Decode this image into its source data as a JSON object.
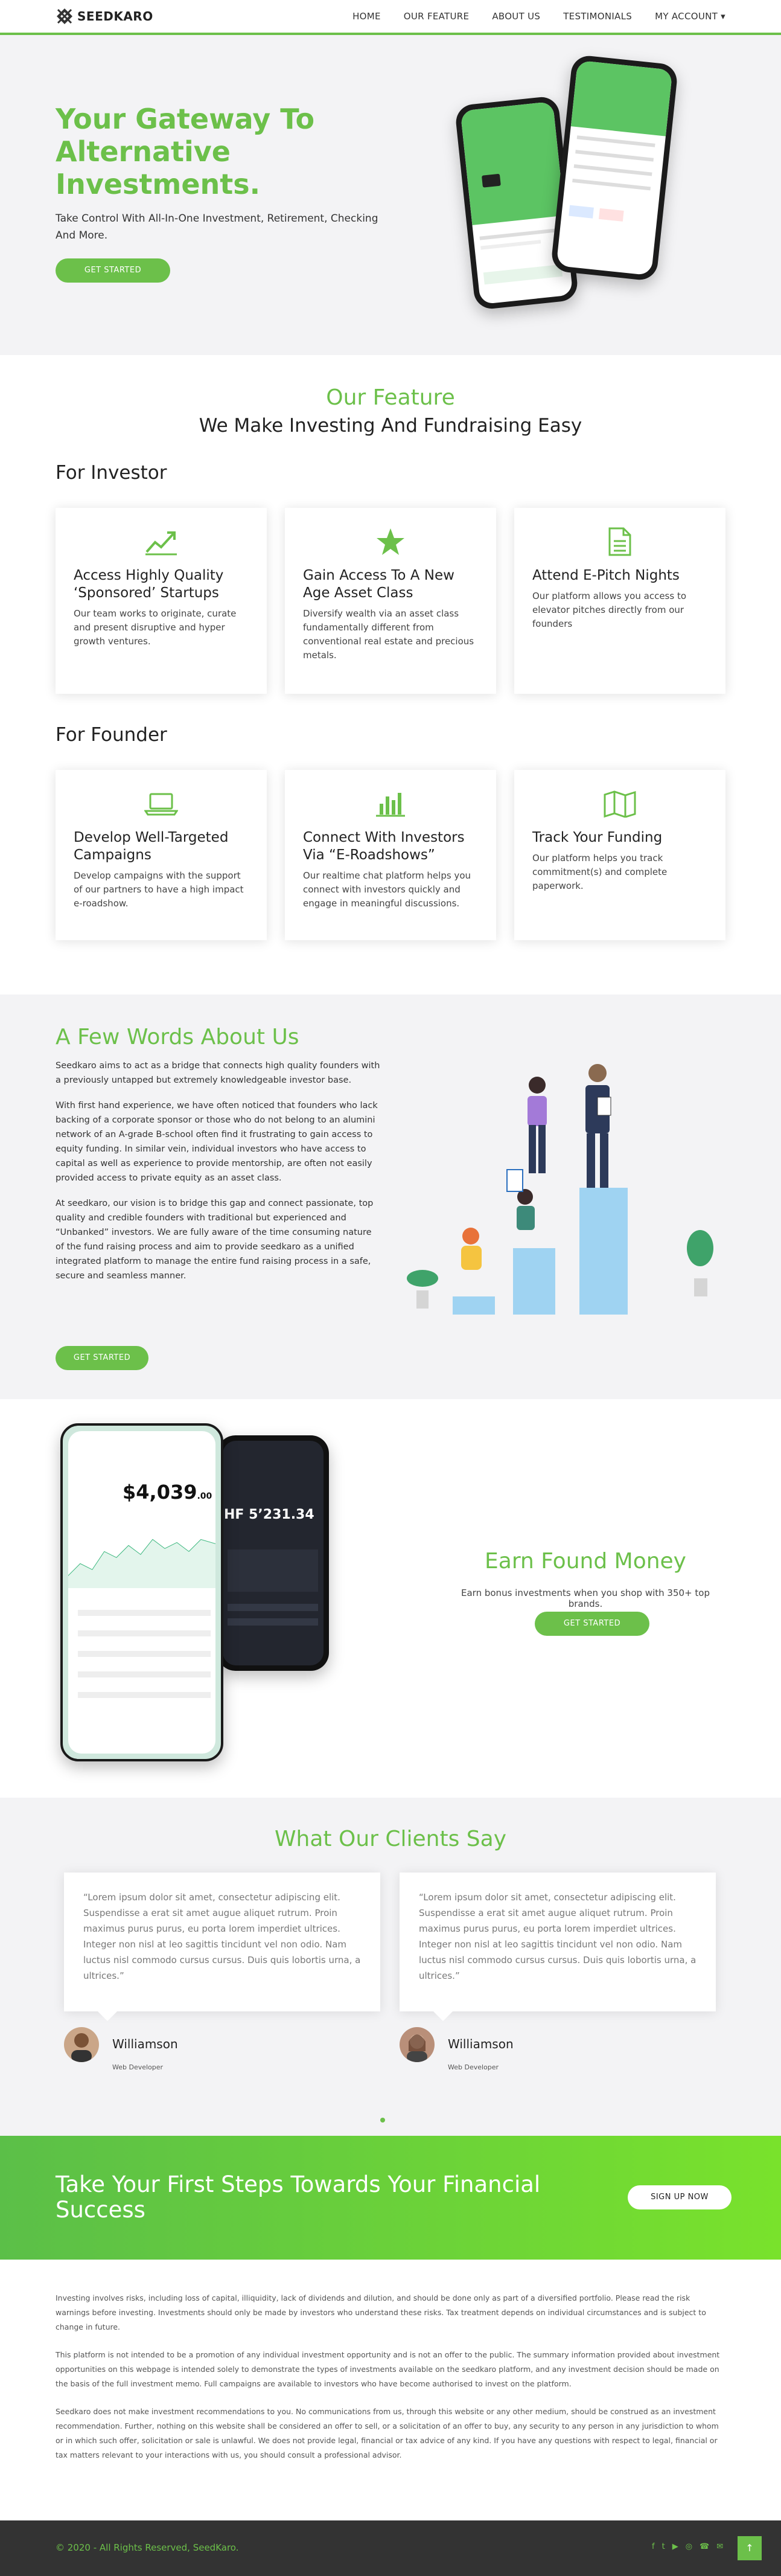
{
  "nav": {
    "brand": "SEEDKARO",
    "items": [
      "HOME",
      "OUR FEATURE",
      "ABOUT US",
      "TESTIMONIALS",
      "MY ACCOUNT ▾"
    ]
  },
  "hero": {
    "title": "Your Gateway To Alternative Investments.",
    "subtitle": "Take Control With All-In-One Investment, Retirement, Checking And More.",
    "cta": "GET STARTED"
  },
  "feature": {
    "heading": "Our Feature",
    "subheading": "We Make Investing And Fundraising Easy",
    "investor_title": "For Investor",
    "investor_cards": [
      {
        "title": "Access Highly Quality ‘Sponsored’ Startups",
        "text": "Our team works to originate, curate and present disruptive and hyper growth ventures.",
        "icon": "trending-up-icon"
      },
      {
        "title": "Gain Access To A New Age Asset Class",
        "text": "Diversify wealth via an asset class fundamentally different from conventional real estate and precious metals.",
        "icon": "star-icon"
      },
      {
        "title": "Attend E-Pitch Nights",
        "text": "Our platform allows you access to elevator pitches directly from our founders",
        "icon": "document-icon"
      }
    ],
    "founder_title": "For Founder",
    "founder_cards": [
      {
        "title": "Develop Well-Targeted Campaigns",
        "text": "Develop campaigns with the support of our partners to have a high impact e-roadshow.",
        "icon": "laptop-icon"
      },
      {
        "title": "Connect With Investors Via “E-Roadshows”",
        "text": "Our realtime chat platform helps you connect with investors quickly and engage in meaningful discussions.",
        "icon": "bar-chart-icon"
      },
      {
        "title": "Track Your Funding",
        "text": "Our platform helps you track commitment(s) and complete paperwork.",
        "icon": "map-icon"
      }
    ]
  },
  "about": {
    "heading": "A Few Words About Us",
    "paragraphs": [
      "Seedkaro aims to act as a bridge that connects high quality founders with a previously untapped but extremely knowledgeable investor base.",
      "With first hand experience, we have often noticed that founders who lack backing of a corporate sponsor or those who do not belong to an alumini network of an A-grade B-school often find it frustrating to gain access to equity funding. In similar vein, individual investors who have access to capital as well as experience to provide mentorship, are often not easily provided access to private equity as an asset class.",
      "At seedkaro, our vision is to bridge this gap and connect passionate, top quality and credible founders with traditional but experienced and “Unbanked” investors. We are fully aware of the time consuming nature of the fund raising process and aim to provide seedkaro as a unified integrated platform to manage the entire fund raising process in a safe, secure and seamless manner."
    ],
    "cta": "GET STARTED"
  },
  "earn": {
    "heading": "Earn Found Money",
    "text": "Earn bonus investments when you shop with 350+ top brands.",
    "cta": "GET STARTED",
    "phone_balance": "4,039",
    "phone_balance_cents": ".00",
    "phone2_amount": "HF 5’231.34"
  },
  "testimonials": {
    "heading": "What Our Clients Say",
    "items": [
      {
        "quote": "“Lorem ipsum dolor sit amet, consectetur adipiscing elit. Suspendisse a erat sit amet augue aliquet rutrum. Proin maximus purus purus, eu porta lorem imperdiet ultrices. Integer non nisl at leo sagittis tincidunt vel non odio. Nam luctus nisl commodo cursus cursus. Duis quis lobortis urna, a ultrices.”",
        "name": "Williamson",
        "role": "Web Developer"
      },
      {
        "quote": "“Lorem ipsum dolor sit amet, consectetur adipiscing elit. Suspendisse a erat sit amet augue aliquet rutrum. Proin maximus purus purus, eu porta lorem imperdiet ultrices. Integer non nisl at leo sagittis tincidunt vel non odio. Nam luctus nisl commodo cursus cursus. Duis quis lobortis urna, a ultrices.”",
        "name": "Williamson",
        "role": "Web Developer"
      }
    ]
  },
  "cta": {
    "heading": "Take Your First Steps Towards Your Financial Success",
    "button": "SIGN UP NOW"
  },
  "disclaimer": [
    "Investing involves risks, including loss of capital, illiquidity, lack of dividends and dilution, and should be done only as part of a diversified portfolio. Please read the risk warnings before investing. Investments should only be made by investors who understand these risks. Tax treatment depends on individual circumstances and is subject to change in future.",
    "This platform is not intended to be a promotion of any individual investment opportunity and is not an offer to the public. The summary information provided about investment opportunities on this webpage is intended solely to demonstrate the types of investments available on the seedkaro platform, and any investment decision should be made on the basis of the full investment memo. Full campaigns are available to investors who have become authorised to invest on the platform.",
    "Seedkaro does not make investment recommendations to you. No communications from us, through this website or any other medium, should be construed as an investment recommendation. Further, nothing on this website shall be considered an offer to sell, or a solicitation of an offer to buy, any security to any person in any jurisdiction to whom or in which such offer, solicitation or sale is unlawful. We does not provide legal, financial or tax advice of any kind. If you have any questions with respect to legal, financial or tax matters relevant to your interactions with us, you should consult a professional advisor."
  ],
  "footer": {
    "copyright": "© 2020 - All Rights Reserved, SeedKaro.",
    "social": [
      "f",
      "t",
      "▶",
      "◎",
      "☎",
      "✉"
    ],
    "back_to_top": "↑"
  },
  "colors": {
    "accent": "#6cc04a",
    "footer": "#333333",
    "section_bg": "#f3f3f5"
  }
}
